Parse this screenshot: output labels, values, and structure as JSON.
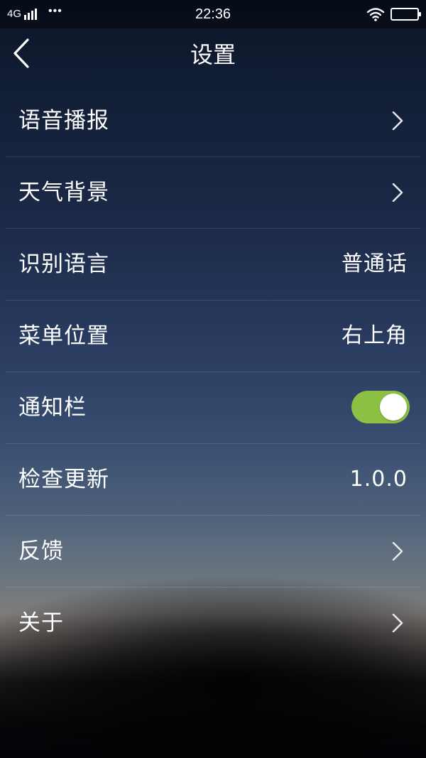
{
  "status_bar": {
    "network": "4G",
    "more": "•••",
    "time": "22:36"
  },
  "header": {
    "title": "设置",
    "back_icon": "chevron-left-icon"
  },
  "settings": {
    "voice_broadcast": {
      "label": "语音播报"
    },
    "weather_background": {
      "label": "天气背景"
    },
    "recognition_language": {
      "label": "识别语言",
      "value": "普通话"
    },
    "menu_position": {
      "label": "菜单位置",
      "value": "右上角"
    },
    "notification_bar": {
      "label": "通知栏",
      "enabled": true
    },
    "check_update": {
      "label": "检查更新",
      "value": "1.0.0"
    },
    "feedback": {
      "label": "反馈"
    },
    "about": {
      "label": "关于"
    }
  },
  "colors": {
    "toggle_on": "#8bc043",
    "text": "#ffffff"
  }
}
